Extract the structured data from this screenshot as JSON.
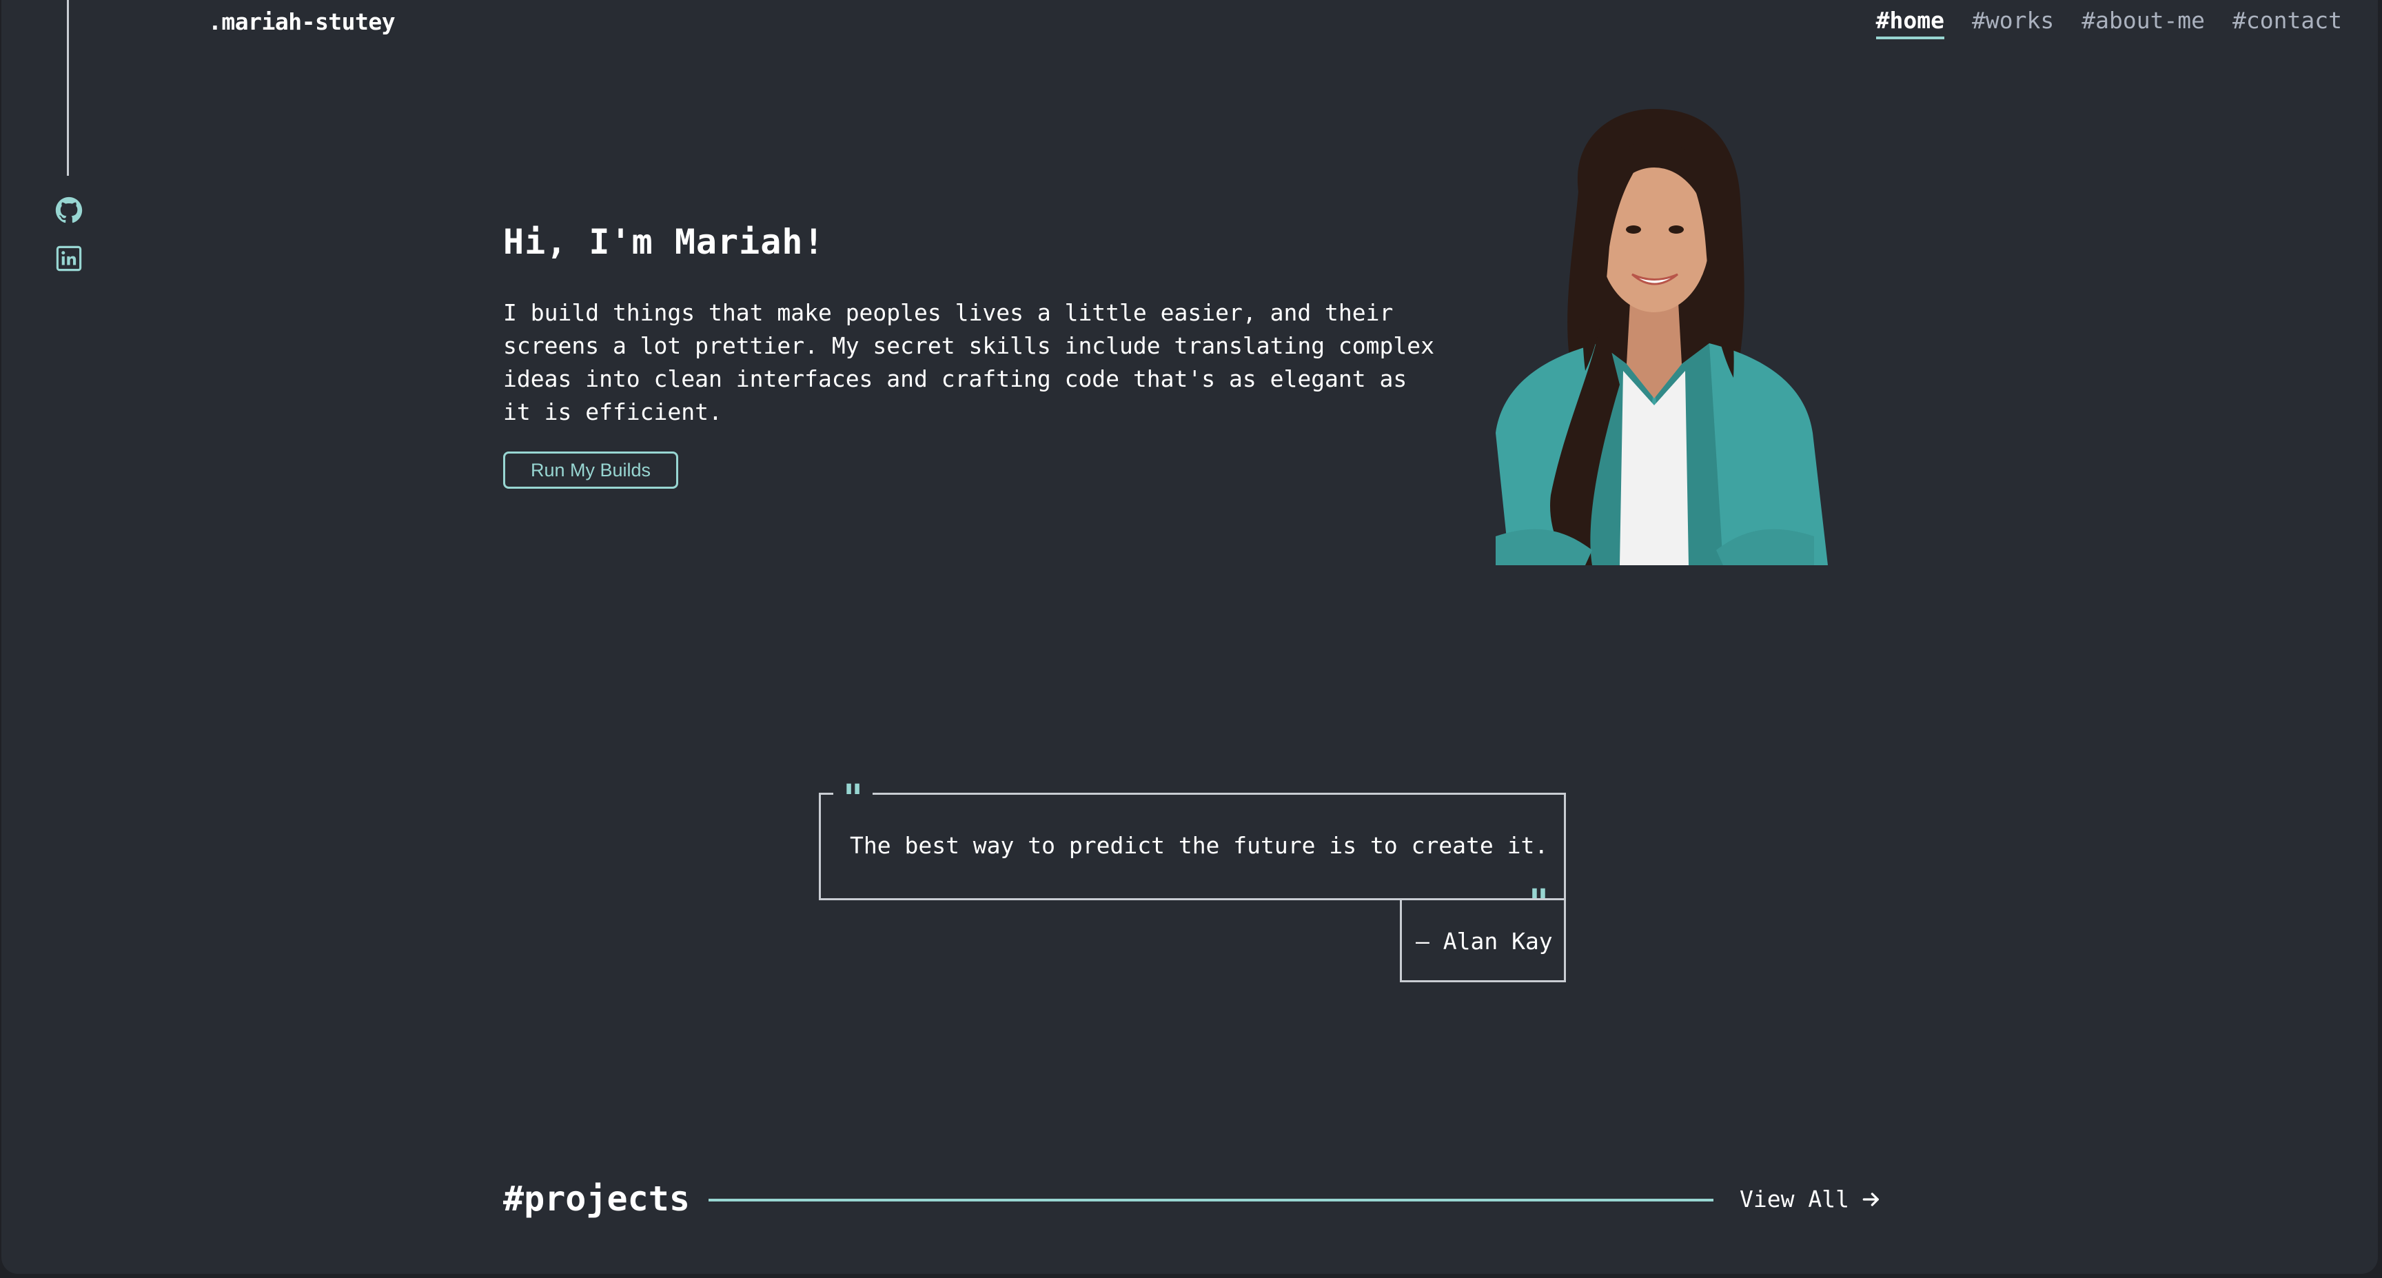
{
  "site": {
    "logo": ".mariah-stutey"
  },
  "nav": {
    "items": [
      {
        "label": "#home"
      },
      {
        "label": "#works"
      },
      {
        "label": "#about-me"
      },
      {
        "label": "#contact"
      }
    ],
    "active": "#home"
  },
  "social": [
    {
      "icon": "github-icon"
    },
    {
      "icon": "linkedin-icon"
    }
  ],
  "hero": {
    "title": "Hi, I'm Mariah!",
    "description": "I build things that make peoples lives a little easier, and their screens a lot prettier. My secret skills include translating complex ideas into clean interfaces and crafting code that's as elegant as it is efficient.",
    "cta_label": "Run My Builds"
  },
  "quote": {
    "text": "The best way to predict the future is to create it.",
    "author": "— Alan Kay"
  },
  "projects": {
    "title": "#projects",
    "view_all_label": "View All"
  },
  "colors": {
    "background": "#282c33",
    "accent": "#98d6d2",
    "text": "#ffffff",
    "muted": "#abb2bf"
  }
}
